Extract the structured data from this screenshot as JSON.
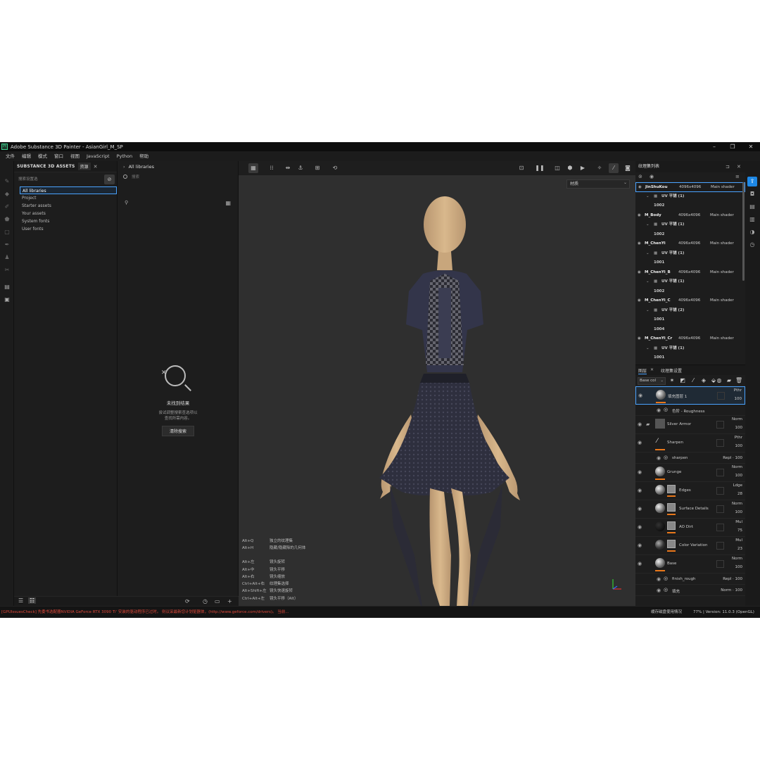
{
  "window": {
    "title": "Adobe Substance 3D Painter - AsianGirl_M_SP",
    "app_icon": "Pt"
  },
  "menu": [
    "文件",
    "编辑",
    "模式",
    "窗口",
    "视图",
    "JavaScript",
    "Python",
    "帮助"
  ],
  "assets": {
    "title": "SUBSTANCE 3D ASSETS",
    "tab": "资源",
    "filter_label": "搜索设置选",
    "libraries": [
      "All libraries",
      "Project",
      "Starter assets",
      "Your assets",
      "System fonts",
      "User fonts"
    ]
  },
  "content": {
    "breadcrumb": "All libraries",
    "search_placeholder": "搜索",
    "empty_title": "未找到结果",
    "empty_line1": "尝试调整搜索查选项以",
    "empty_line2": "查找所需内容。",
    "clear_button": "清除搜索"
  },
  "viewport": {
    "dropdown": "材质",
    "shortcuts": [
      {
        "key": "Alt+Q",
        "desc": "独立的纹理集"
      },
      {
        "key": "Alt+H",
        "desc": "隐藏/隐藏除的几何体"
      },
      {
        "key": "",
        "desc": ""
      },
      {
        "key": "Alt+左",
        "desc": "镜头旋转"
      },
      {
        "key": "Alt+中",
        "desc": "镜头平移"
      },
      {
        "key": "Alt+右",
        "desc": "镜头缩放"
      },
      {
        "key": "Ctrl+Alt+右",
        "desc": "纹理集选择"
      },
      {
        "key": "Alt+Shift+左",
        "desc": "镜头快速旋转"
      },
      {
        "key": "Ctrl+Alt+左",
        "desc": "镜头平移（Alt）"
      }
    ]
  },
  "texture_sets": {
    "title": "纹理集列表",
    "rows": [
      {
        "type": "ts",
        "name": "JinShuKou",
        "res": "4096x4096",
        "shader": "Main shader"
      },
      {
        "type": "uv",
        "name": "UV 平铺 (1)"
      },
      {
        "type": "udim",
        "name": "1002"
      },
      {
        "type": "ts",
        "name": "M_Body",
        "res": "4096x4096",
        "shader": "Main shader"
      },
      {
        "type": "uv",
        "name": "UV 平铺 (1)"
      },
      {
        "type": "udim",
        "name": "1002"
      },
      {
        "type": "ts",
        "name": "M_ChenYi",
        "res": "4096x4096",
        "shader": "Main shader"
      },
      {
        "type": "uv",
        "name": "UV 平铺 (1)"
      },
      {
        "type": "udim",
        "name": "1001"
      },
      {
        "type": "ts",
        "name": "M_ChenYi_B",
        "res": "4096x4096",
        "shader": "Main shader"
      },
      {
        "type": "uv",
        "name": "UV 平铺 (1)"
      },
      {
        "type": "udim",
        "name": "1002"
      },
      {
        "type": "ts",
        "name": "M_ChenYi_C",
        "res": "4096x4096",
        "shader": "Main shader"
      },
      {
        "type": "uv",
        "name": "UV 平铺 (2)"
      },
      {
        "type": "udim",
        "name": "1001"
      },
      {
        "type": "udim",
        "name": "1004"
      },
      {
        "type": "ts",
        "name": "M_ChenYi_Cr",
        "res": "4096x4096",
        "shader": "Main shader"
      },
      {
        "type": "uv",
        "name": "UV 平铺 (1)"
      },
      {
        "type": "udim",
        "name": "1001"
      }
    ]
  },
  "layers": {
    "tab_layers": "图层",
    "tab_settings": "纹理集设置",
    "channel": "Base col",
    "items": [
      {
        "name": "填充图层 1",
        "blend": "Pthr",
        "opacity": "100",
        "kind": "fill",
        "sub": {
          "name": "色阶 - Roughness",
          "right": ""
        }
      },
      {
        "name": "Silver Armor",
        "blend": "Norm",
        "opacity": "100",
        "kind": "folder"
      },
      {
        "name": "Sharpen",
        "blend": "Pthr",
        "opacity": "100",
        "kind": "paint",
        "sub": {
          "name": "sharpen",
          "right": "Repl · 100"
        }
      },
      {
        "name": "Grunge",
        "blend": "Norm",
        "opacity": "100",
        "kind": "fill"
      },
      {
        "name": "Edges",
        "blend": "Ldge",
        "opacity": "28",
        "kind": "mask"
      },
      {
        "name": "Surface Details",
        "blend": "Norm",
        "opacity": "100",
        "kind": "mask"
      },
      {
        "name": "AO Dirt",
        "blend": "Mul",
        "opacity": "75",
        "kind": "black"
      },
      {
        "name": "Color Variation",
        "blend": "Mul",
        "opacity": "23",
        "kind": "dark"
      },
      {
        "name": "Base",
        "blend": "Norm",
        "opacity": "100",
        "kind": "fill",
        "subs": [
          {
            "name": "finish_rough",
            "right": "Repl · 100"
          },
          {
            "name": "填充",
            "right": "Norm · 100"
          }
        ]
      }
    ]
  },
  "status": {
    "warning": "[GPUIssuesCheck] 先委书选配器NVIDIA GeForce RTX 3090 Ti' 安装的驱动程序已过时。 则议采最新您计划驱器体，(http://www.geforce.com/drivers)。 当前...",
    "memory": "缓存磁盘使用情况",
    "version": "77% | Version: 11.0.3 (OpenGL)"
  }
}
